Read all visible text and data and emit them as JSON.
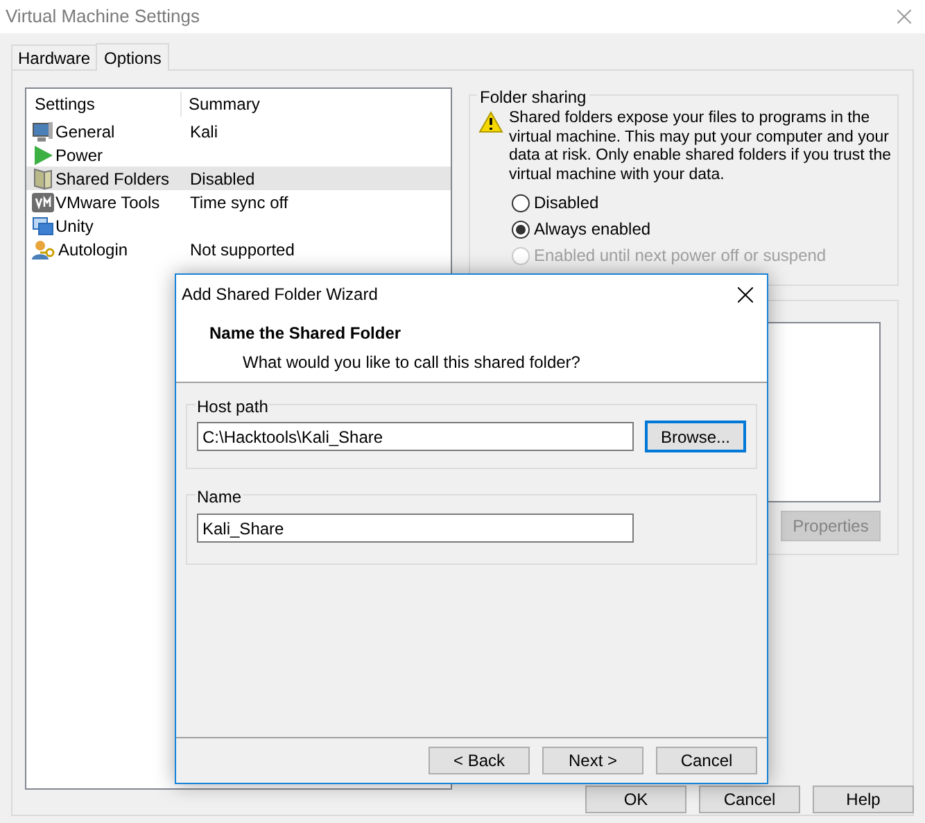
{
  "window": {
    "title": "Virtual Machine Settings"
  },
  "tabs": [
    {
      "label": "Hardware",
      "selected": false
    },
    {
      "label": "Options",
      "selected": true
    }
  ],
  "settings_list": {
    "columns": [
      "Settings",
      "Summary"
    ],
    "items": [
      {
        "label": "General",
        "summary": "Kali",
        "selected": false
      },
      {
        "label": "Power",
        "selected": false
      },
      {
        "label": "Shared Folders",
        "summary": "Disabled",
        "selected": true
      },
      {
        "label": "VMware Tools",
        "summary": "Time sync off",
        "selected": false
      },
      {
        "label": "Unity",
        "selected": false
      },
      {
        "label": "Autologin",
        "summary": "Not supported",
        "selected": false
      }
    ]
  },
  "folder_sharing": {
    "title": "Folder sharing",
    "warning": "Shared folders expose your files to programs in the virtual machine. This may put your computer and your data at risk. Only enable shared folders if you trust the virtual machine with your data.",
    "options": [
      {
        "label": "Disabled",
        "selected": false,
        "disabled": false
      },
      {
        "label": "Always enabled",
        "selected": true,
        "disabled": false
      },
      {
        "label": "Enabled until next power off or suspend",
        "selected": false,
        "disabled": true
      }
    ]
  },
  "folders": {
    "properties_button": {
      "label": "Properties",
      "disabled": true
    }
  },
  "buttons": [
    "OK",
    "Cancel",
    "Help"
  ],
  "dialog": {
    "title": "Add Shared Folder Wizard",
    "heading": "Name the Shared Folder",
    "subtitle": "What would you like to call this shared folder?",
    "host_path": {
      "label": "Host path",
      "value": "C:\\Hacktools\\Kali_Share"
    },
    "browse_button": "Browse...",
    "name": {
      "label": "Name",
      "value": "Kali_Share"
    },
    "buttons": [
      "< Back",
      "Next >",
      "Cancel"
    ]
  }
}
